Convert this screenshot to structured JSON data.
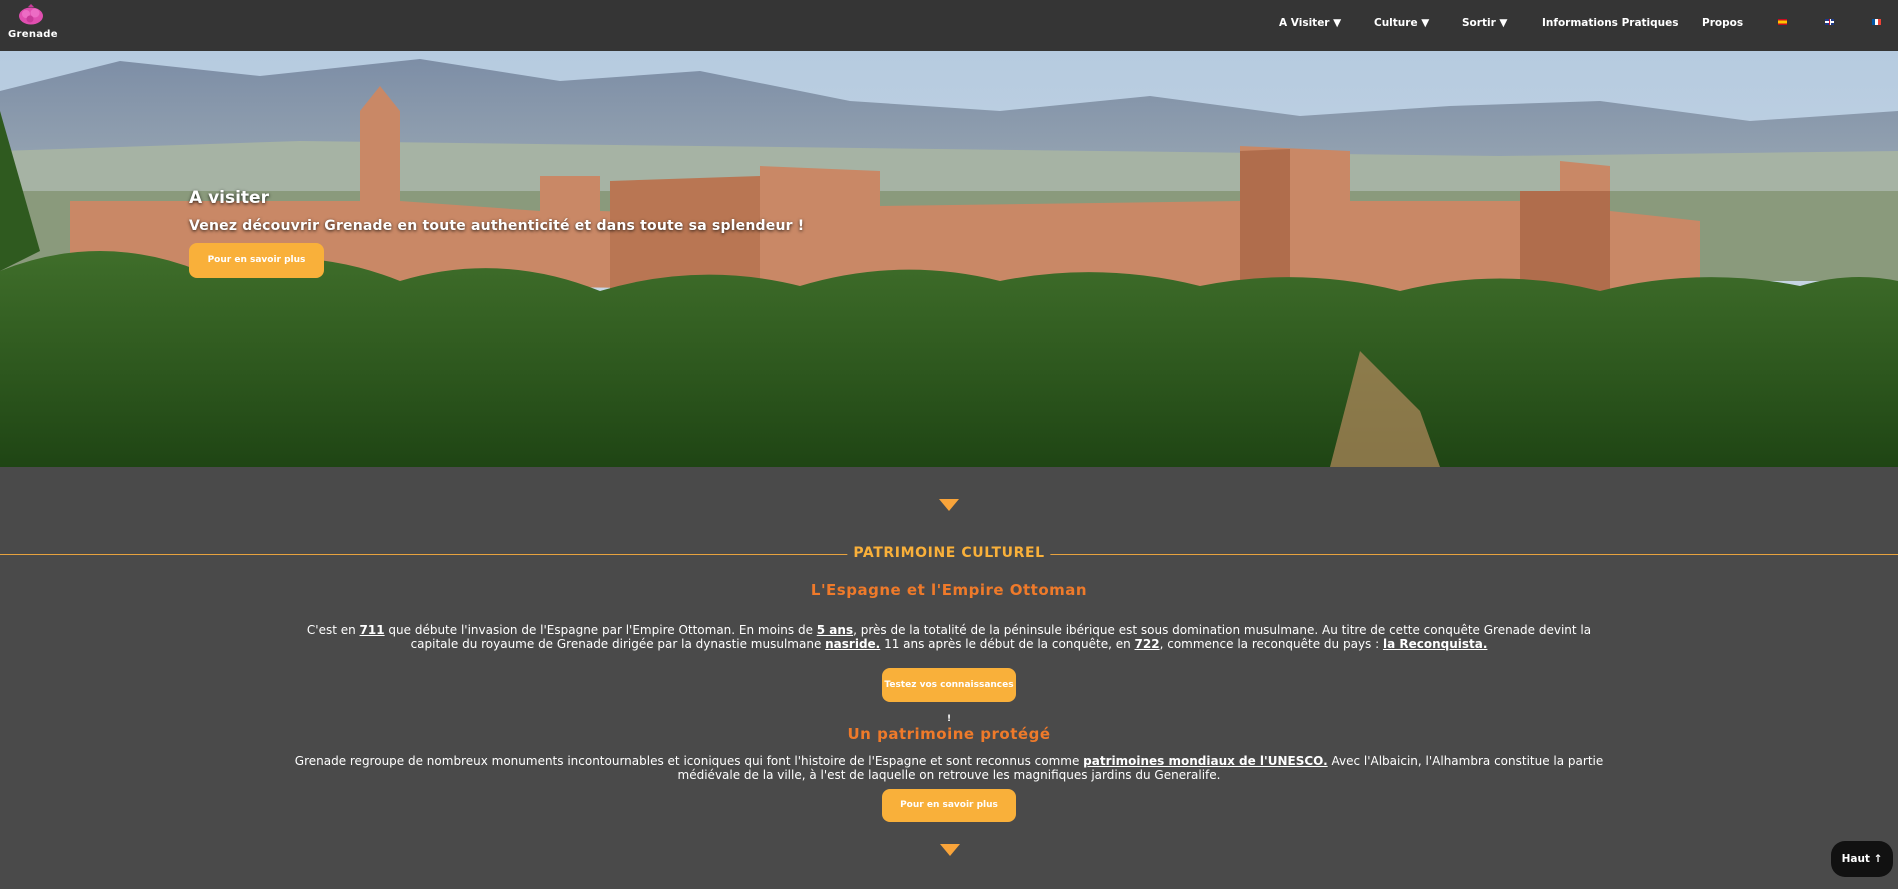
{
  "brand": {
    "name": "Grenade",
    "logo_icon": "pink-pomegranate-logo",
    "logo_color": "#e04fb0"
  },
  "nav": {
    "items": [
      {
        "label": "A Visiter ▼"
      },
      {
        "label": "Culture ▼"
      },
      {
        "label": "Sortir ▼"
      },
      {
        "label": "Informations Pratiques"
      },
      {
        "label": "Propos"
      }
    ],
    "flags": [
      "spanish-flag-icon",
      "english-flag-icon",
      "french-flag-icon"
    ]
  },
  "hero": {
    "title": "A visiter",
    "subtitle": "Venez découvrir Grenade en toute authenticité et dans toute sa splendeur !",
    "button": "Pour en savoir plus"
  },
  "section": {
    "title": "PATRIMOINE CULTUREL",
    "accent_color": "#f9b03a",
    "heading_color": "#ef7a2a",
    "block1": {
      "heading": "L'Espagne et l'Empire Ottoman",
      "p": {
        "t1": "C'est en ",
        "l1": "711",
        "t2": " que débute l'invasion de l'Espagne par l'Empire Ottoman. En moins de ",
        "l2": "5 ans",
        "t3": ", près de la totalité de la péninsule ibérique est sous domination musulmane. Au titre de cette conquête Grenade devint la capitale du royaume de Grenade dirigée par la dynastie musulmane ",
        "l3": "nasride.",
        "t4": " 11 ans après le début de la conquête, en ",
        "l4": "722",
        "t5": ", commence la reconquête du pays : ",
        "l5": "la Reconquista."
      },
      "button": "Testez vos connaissances !"
    },
    "block2": {
      "heading": "Un patrimoine protégé",
      "p": {
        "t1": "Grenade regroupe de nombreux monuments incontournables et iconiques qui font l'histoire de l'Espagne et sont reconnus comme ",
        "l1": "patrimoines mondiaux de l'UNESCO.",
        "t2": " Avec l'Albaicin, l'Alhambra constitue la partie médiévale de la ville, à l'est de laquelle on retrouve les magnifiques jardins du Generalife."
      },
      "button": "Pour en savoir plus"
    }
  },
  "back_to_top": "Haut ↑"
}
